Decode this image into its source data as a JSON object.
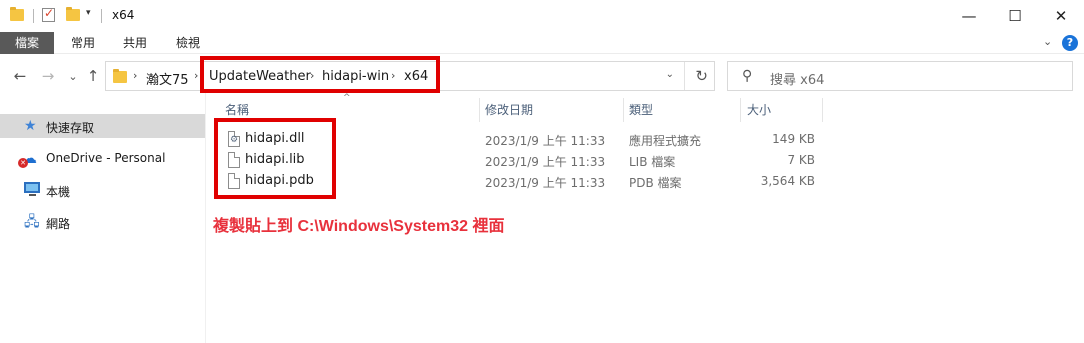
{
  "window": {
    "title": "x64",
    "minimize_glyph": "—",
    "maximize_glyph": "☐",
    "close_glyph": "✕",
    "qa_dropdown_glyph": "▾"
  },
  "ribbon": {
    "tabs": [
      "檔案",
      "常用",
      "共用",
      "檢視"
    ],
    "expand_glyph": "⌄",
    "help_glyph": "?"
  },
  "nav": {
    "back_glyph": "←",
    "forward_glyph": "→",
    "recent_glyph": "⌄",
    "up_glyph": "↑"
  },
  "address": {
    "separator": "›",
    "crumbs": [
      "瀚文75",
      "UpdateWeather",
      "hidapi-win",
      "x64"
    ],
    "dropdown_glyph": "⌄",
    "refresh_glyph": "↻"
  },
  "search": {
    "placeholder": "搜尋 x64",
    "icon_glyph": "⚲"
  },
  "sidebar": {
    "items": [
      {
        "label": "快速存取",
        "icon": "star-icon",
        "glyph": "★"
      },
      {
        "label": "OneDrive - Personal",
        "icon": "onedrive-cloud-icon",
        "glyph": "☁"
      },
      {
        "label": "本機",
        "icon": "this-pc-icon",
        "glyph": ""
      },
      {
        "label": "網路",
        "icon": "network-icon",
        "glyph": "🖧"
      }
    ],
    "error_badge": "✕"
  },
  "columns": {
    "name": "名稱",
    "date": "修改日期",
    "type": "類型",
    "size": "大小",
    "sort_glyph": "^"
  },
  "files": [
    {
      "name": "hidapi.dll",
      "date": "2023/1/9 上午 11:33",
      "type": "應用程式擴充",
      "size": "149 KB",
      "icon": "dll-file-icon"
    },
    {
      "name": "hidapi.lib",
      "date": "2023/1/9 上午 11:33",
      "type": "LIB 檔案",
      "size": "7 KB",
      "icon": "lib-file-icon"
    },
    {
      "name": "hidapi.pdb",
      "date": "2023/1/9 上午 11:33",
      "type": "PDB 檔案",
      "size": "3,564 KB",
      "icon": "pdb-file-icon"
    }
  ],
  "annotation": {
    "text": "複製貼上到 C:\\Windows\\System32 裡面",
    "color": "#e8313c",
    "box_color": "#e00000"
  }
}
